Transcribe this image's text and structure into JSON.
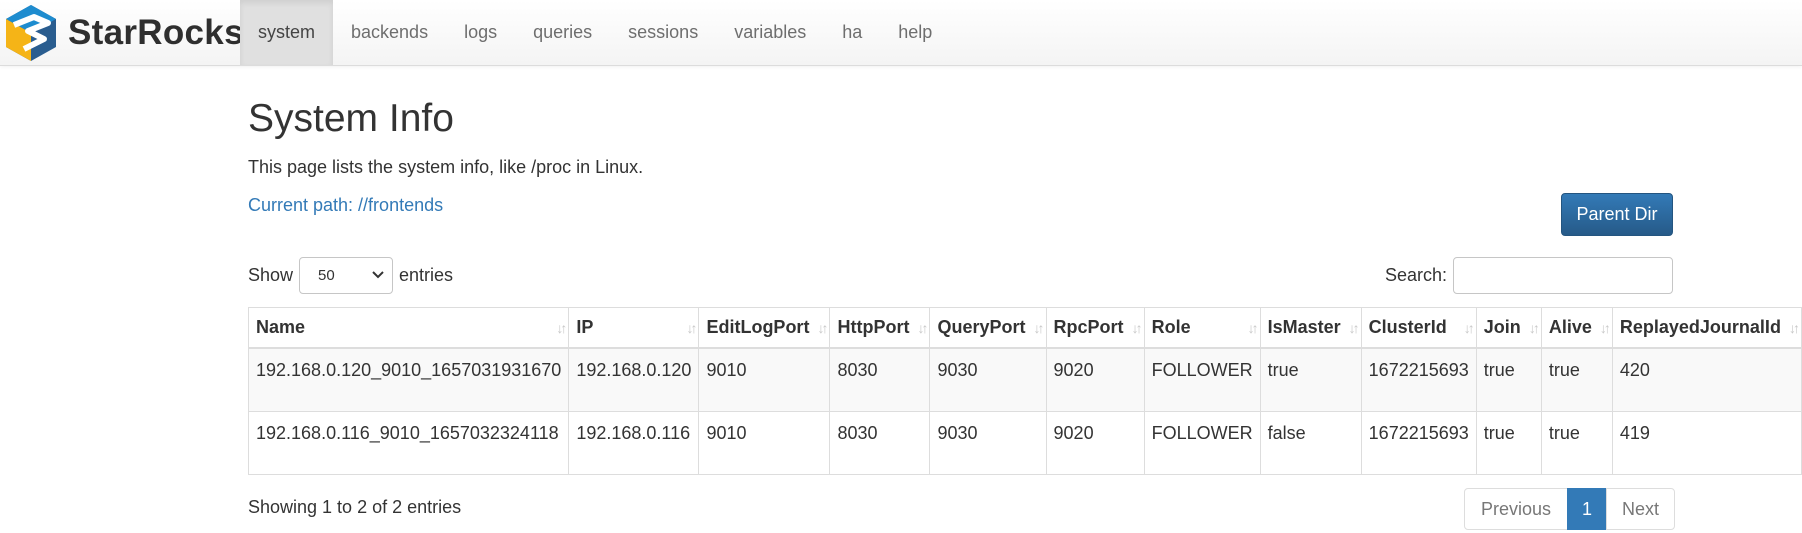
{
  "brand": {
    "name": "StarRocks"
  },
  "nav": {
    "items": [
      {
        "label": "system",
        "active": true
      },
      {
        "label": "backends"
      },
      {
        "label": "logs"
      },
      {
        "label": "queries"
      },
      {
        "label": "sessions"
      },
      {
        "label": "variables"
      },
      {
        "label": "ha"
      },
      {
        "label": "help"
      }
    ]
  },
  "page": {
    "title": "System Info",
    "description": "This page lists the system info, like /proc in Linux.",
    "current_path": "Current path: //frontends",
    "parent_button": "Parent Dir"
  },
  "controls": {
    "show_label": "Show",
    "page_size": "50",
    "entries_label": "entries",
    "search_label": "Search:",
    "search_value": ""
  },
  "table": {
    "columns": [
      "Name",
      "IP",
      "EditLogPort",
      "HttpPort",
      "QueryPort",
      "RpcPort",
      "Role",
      "IsMaster",
      "ClusterId",
      "Join",
      "Alive",
      "ReplayedJournalId"
    ],
    "rows": [
      [
        "192.168.0.120_9010_1657031931670",
        "192.168.0.120",
        "9010",
        "8030",
        "9030",
        "9020",
        "FOLLOWER",
        "true",
        "1672215693",
        "true",
        "true",
        "420"
      ],
      [
        "192.168.0.116_9010_1657032324118",
        "192.168.0.116",
        "9010",
        "8030",
        "9030",
        "9020",
        "FOLLOWER",
        "false",
        "1672215693",
        "true",
        "true",
        "419"
      ]
    ]
  },
  "footer": {
    "info": "Showing 1 to 2 of 2 entries",
    "previous": "Previous",
    "current_page": "1",
    "next": "Next"
  },
  "icons": {
    "sort": "sort-icon",
    "select_arrow": "chevron-down-icon"
  },
  "colors": {
    "primary": "#337ab7",
    "nav_active_bg": "#e0e0e0",
    "logo_yellow": "#f5b417",
    "logo_blue": "#1e8ccf",
    "logo_dark": "#2a5d8f"
  }
}
